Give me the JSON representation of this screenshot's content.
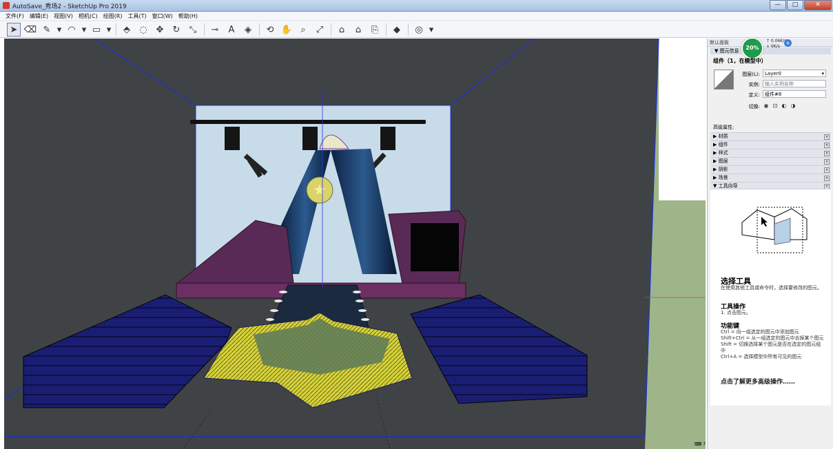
{
  "window": {
    "title": "AutoSave_秀场2 - SketchUp Pro 2019",
    "minimize": "—",
    "maximize": "□",
    "close": "✕"
  },
  "menu": [
    "文件(F)",
    "编辑(E)",
    "视图(V)",
    "相机(C)",
    "绘图(R)",
    "工具(T)",
    "窗口(W)",
    "帮助(H)"
  ],
  "toolbar": {
    "tools": [
      {
        "name": "select-tool",
        "glyph": "➤"
      },
      {
        "name": "eraser-tool",
        "glyph": "⌫"
      },
      {
        "name": "pencil-tool",
        "glyph": "✎"
      },
      {
        "name": "pencil-dropdown",
        "glyph": "▾"
      },
      {
        "name": "arc-tool",
        "glyph": "◠"
      },
      {
        "name": "arc-dropdown",
        "glyph": "▾"
      },
      {
        "name": "rectangle-tool",
        "glyph": "▭"
      },
      {
        "name": "rectangle-dropdown",
        "glyph": "▾"
      },
      {
        "name": "push-pull-tool",
        "glyph": "⬘"
      },
      {
        "name": "offset-tool",
        "glyph": "◌"
      },
      {
        "name": "move-tool",
        "glyph": "✥"
      },
      {
        "name": "rotate-tool",
        "glyph": "↻"
      },
      {
        "name": "scale-tool",
        "glyph": "⤡"
      },
      {
        "name": "tape-measure-tool",
        "glyph": "⊸"
      },
      {
        "name": "text-tool",
        "glyph": "A"
      },
      {
        "name": "paint-bucket-tool",
        "glyph": "◈"
      },
      {
        "name": "orbit-tool",
        "glyph": "⟲"
      },
      {
        "name": "pan-tool",
        "glyph": "✋"
      },
      {
        "name": "zoom-tool",
        "glyph": "⌕"
      },
      {
        "name": "zoom-extents-tool",
        "glyph": "⤢"
      },
      {
        "name": "warehouse-tool",
        "glyph": "⌂"
      },
      {
        "name": "extension-warehouse-tool",
        "glyph": "⌂"
      },
      {
        "name": "layout-send-tool",
        "glyph": "⎘"
      },
      {
        "name": "ruby-tool",
        "glyph": "◆"
      },
      {
        "name": "account-tool",
        "glyph": "◎"
      },
      {
        "name": "account-dropdown",
        "glyph": "▾"
      }
    ]
  },
  "panel": {
    "header": "默认面板",
    "entity_info_label": "▼ 图元信息",
    "cpu_percent": "20%",
    "net_up": "↑ 0.06K/s",
    "net_down": "↓ 0K/s",
    "net_plus": "+",
    "component_title": "组件（1，在模型中）",
    "layer_label": "图层(L):",
    "layer_value": "Layer0",
    "instance_label": "实例:",
    "instance_placeholder": "输入实例名称",
    "definition_label": "定义:",
    "definition_value": "组件#8",
    "toggle_label": "切换:",
    "advanced_label": "高级属性:",
    "sections": [
      "▶ 材质",
      "▶ 组件",
      "▶ 样式",
      "▶ 图层",
      "▶ 阴影",
      "▶ 场景",
      "▼ 工具向导"
    ],
    "instructor": {
      "title": "选择工具",
      "desc": "在使用其他工具或命令时，选择要修改的图元。",
      "ops_heading": "工具操作",
      "ops_text": "1. 点击图元。",
      "keys_heading": "功能键",
      "keys_text": "Ctrl = 向一组选定的图元中添加图元\nShift+Ctrl = 从一组选定的图元中去掉某个图元\nShift = 切换选择某个图元是否在选定的图元组中\nCtrl+A = 选择模型中所有可见的图元",
      "more_link": "点击了解更多高级操作……"
    }
  },
  "colors": {
    "viewport_bg": "#404346",
    "sky": "#c8dbe8",
    "ground": "#9db588",
    "seating": "#1a1e72",
    "stage_purple": "#5a2a57",
    "star_yellow": "#d6d23a"
  }
}
